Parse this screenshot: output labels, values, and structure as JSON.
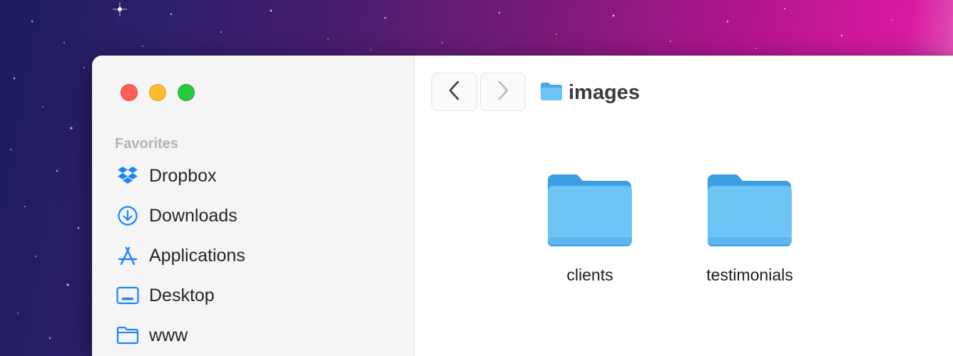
{
  "window": {
    "controls": {
      "close_color": "#ff5f57",
      "minimize_color": "#febc2e",
      "maximize_color": "#28c840"
    }
  },
  "sidebar": {
    "section_title": "Favorites",
    "items": [
      {
        "label": "Dropbox",
        "icon": "dropbox-icon"
      },
      {
        "label": "Downloads",
        "icon": "download-circle-icon"
      },
      {
        "label": "Applications",
        "icon": "applications-icon"
      },
      {
        "label": "Desktop",
        "icon": "desktop-icon"
      },
      {
        "label": "www",
        "icon": "folder-outline-icon"
      }
    ],
    "accent_color": "#1a84ff"
  },
  "toolbar": {
    "back_icon": "chevron-left-icon",
    "forward_icon": "chevron-right-icon",
    "current_folder": "images"
  },
  "content": {
    "folders": [
      {
        "name": "clients",
        "icon": "folder-icon"
      },
      {
        "name": "testimonials",
        "icon": "folder-icon"
      }
    ],
    "folder_color": "#6cc4f5"
  }
}
